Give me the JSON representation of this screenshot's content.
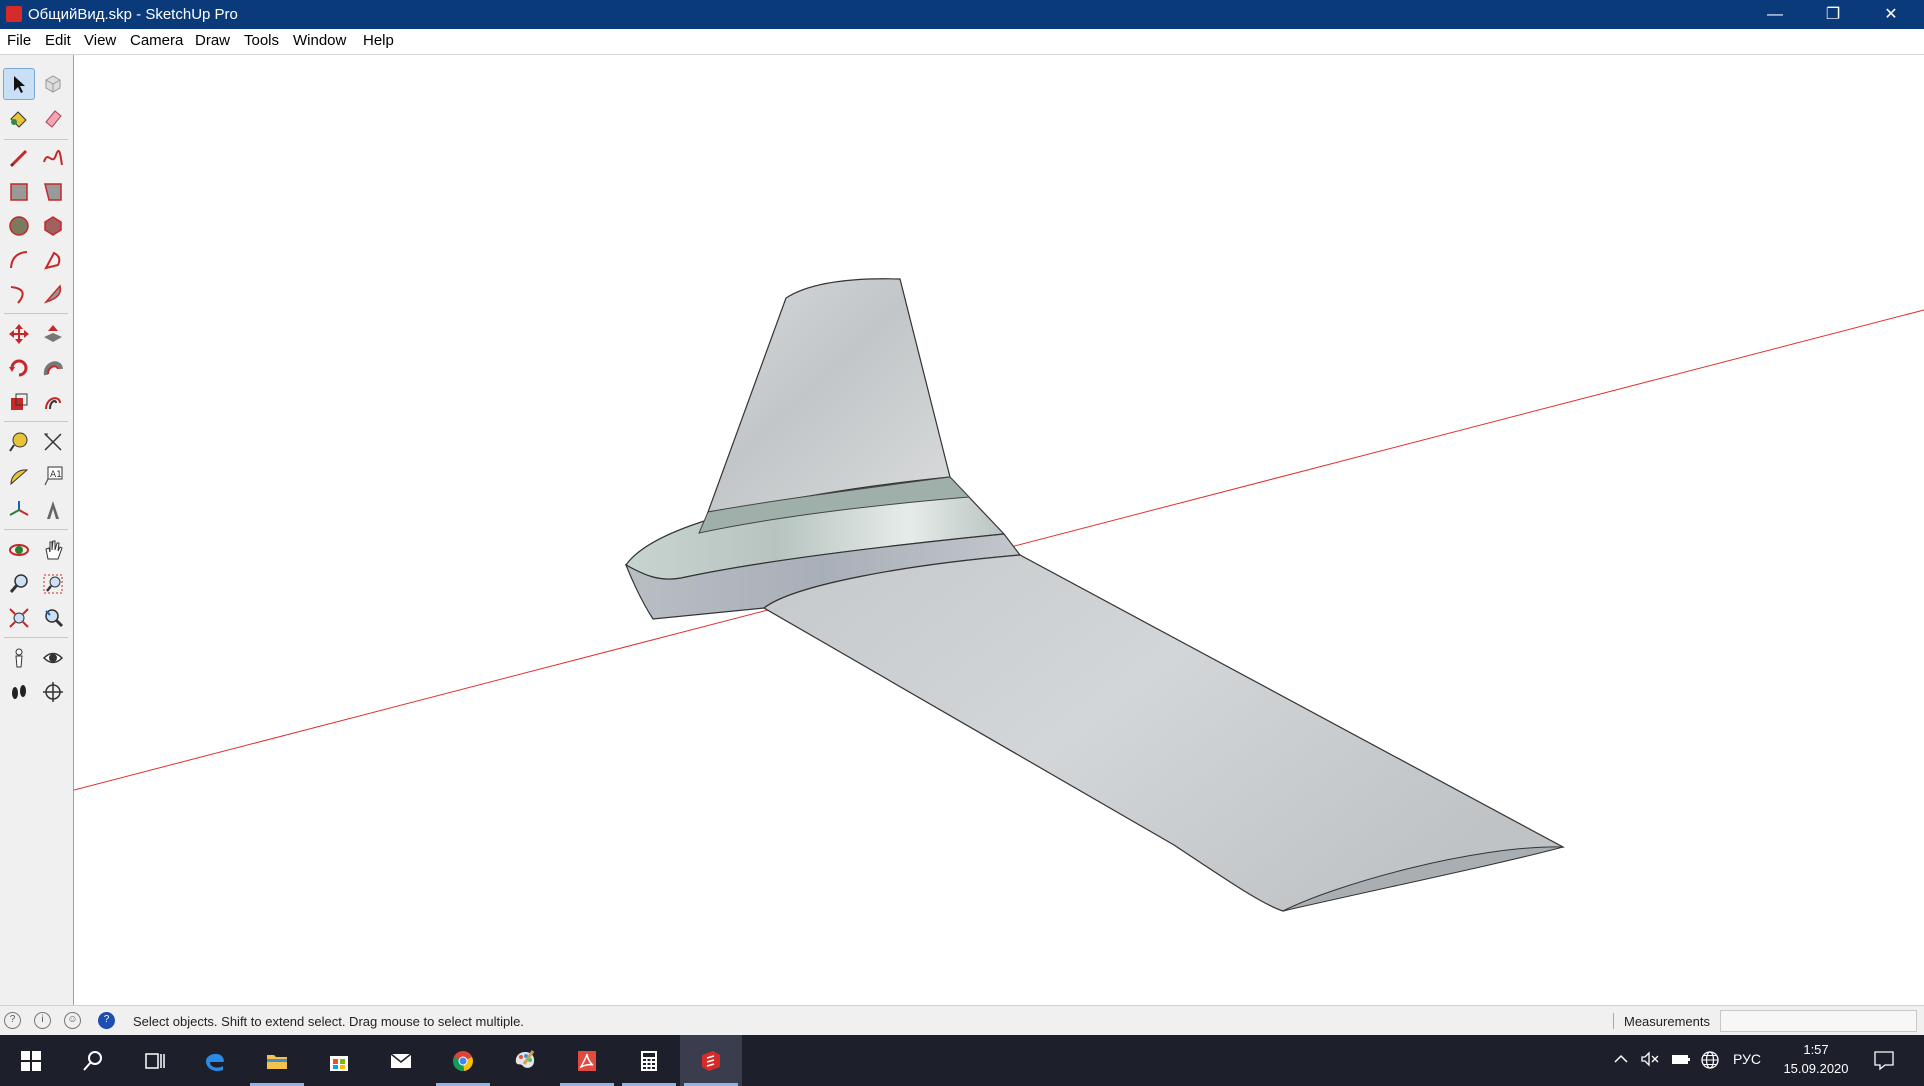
{
  "window": {
    "title": "ОбщийВид.skp - SketchUp Pro",
    "minimize_glyph": "—",
    "maximize_glyph": "❐",
    "close_glyph": "✕"
  },
  "menu": [
    "File",
    "Edit",
    "View",
    "Camera",
    "Draw",
    "Tools",
    "Window",
    "Help"
  ],
  "toolbar": {
    "tools": [
      "select-tool",
      "component-tool",
      "paint-bucket-tool",
      "eraser-tool",
      "line-tool",
      "freehand-tool",
      "rectangle-tool",
      "rotated-rectangle-tool",
      "circle-tool",
      "polygon-tool",
      "arc-tool",
      "two-point-arc-tool",
      "three-point-arc-tool",
      "pie-tool",
      "move-tool",
      "push-pull-tool",
      "rotate-tool",
      "follow-me-tool",
      "scale-tool",
      "offset-tool",
      "tape-measure-tool",
      "dimension-tool",
      "protractor-tool",
      "text-tool",
      "axes-tool",
      "3d-text-tool",
      "orbit-tool",
      "pan-tool",
      "zoom-tool",
      "zoom-window-tool",
      "zoom-extents-tool",
      "previous-view-tool",
      "position-camera-tool",
      "look-around-tool",
      "walk-tool",
      "section-plane-tool"
    ]
  },
  "statusbar": {
    "hint": "Select objects. Shift to extend select. Drag mouse to select multiple.",
    "measurements_label": "Measurements",
    "measurements_value": ""
  },
  "taskbar": {
    "apps": [
      "start-button",
      "search-button",
      "task-view-button",
      "edge-app",
      "file-explorer-app",
      "store-app",
      "mail-app",
      "chrome-app",
      "paint-app",
      "pdf-app",
      "calculator-app",
      "sketchup-app"
    ],
    "language": "РУС",
    "time": "1:57",
    "date": "15.09.2020"
  },
  "colors": {
    "titlebar": "#0b3a7a",
    "taskbar": "#1d1f2a",
    "red_axis": "#e03030",
    "wing_surface": "#c9ccce"
  }
}
